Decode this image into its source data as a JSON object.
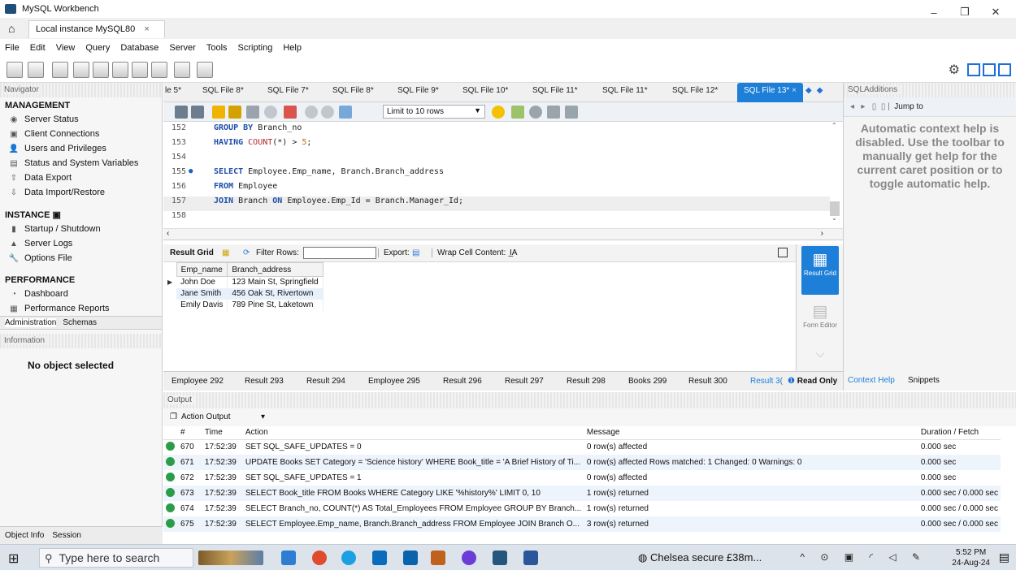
{
  "window": {
    "app_title": "MySQL Workbench",
    "minimize": "–",
    "maximize": "❐",
    "close": "✕"
  },
  "connection_tab": {
    "label": "Local instance MySQL80",
    "close": "×"
  },
  "menu": [
    "File",
    "Edit",
    "View",
    "Query",
    "Database",
    "Server",
    "Tools",
    "Scripting",
    "Help"
  ],
  "navigator": {
    "title": "Navigator",
    "management_title": "MANAGEMENT",
    "management": [
      "Server Status",
      "Client Connections",
      "Users and Privileges",
      "Status and System Variables",
      "Data Export",
      "Data Import/Restore"
    ],
    "instance_title": "INSTANCE",
    "instance": [
      "Startup / Shutdown",
      "Server Logs",
      "Options File"
    ],
    "performance_title": "PERFORMANCE",
    "performance": [
      "Dashboard",
      "Performance Reports"
    ],
    "tabs": [
      "Administration",
      "Schemas"
    ],
    "information_title": "Information",
    "no_object": "No object selected",
    "bottom_tabs": [
      "Object Info",
      "Session"
    ]
  },
  "editor_tabs": [
    "le 5*",
    "SQL File 8*",
    "SQL File 7*",
    "SQL File 8*",
    "SQL File 9*",
    "SQL File 10*",
    "SQL File 11*",
    "SQL File 11*",
    "SQL File 12*",
    "SQL File 13*"
  ],
  "sql_toolbar": {
    "limit": "Limit to 10 rows"
  },
  "code_lines": [
    {
      "num": "152",
      "parts": [
        [
          "kw",
          "GROUP BY "
        ],
        [
          "",
          "Branch_no"
        ]
      ]
    },
    {
      "num": "153",
      "parts": [
        [
          "kw",
          "HAVING "
        ],
        [
          "fn",
          "COUNT"
        ],
        [
          "",
          "(*) > "
        ],
        [
          "num",
          "5"
        ],
        [
          "",
          ";"
        ]
      ]
    },
    {
      "num": "154",
      "parts": []
    },
    {
      "num": "155",
      "dot": "●",
      "parts": [
        [
          "kw",
          "SELECT "
        ],
        [
          "",
          "Employee.Emp_name, Branch.Branch_address"
        ]
      ]
    },
    {
      "num": "156",
      "parts": [
        [
          "kw",
          "FROM "
        ],
        [
          "",
          "Employee"
        ]
      ]
    },
    {
      "num": "157",
      "current": true,
      "parts": [
        [
          "kw",
          "JOIN "
        ],
        [
          "",
          "Branch "
        ],
        [
          "kw",
          "ON "
        ],
        [
          "",
          "Employee.Emp_Id = Branch.Manager_Id;"
        ]
      ]
    },
    {
      "num": "158",
      "parts": []
    }
  ],
  "result_toolbar": {
    "result_grid": "Result Grid",
    "filter_rows": "Filter Rows:",
    "export": "Export:",
    "wrap": "Wrap Cell Content:"
  },
  "result_grid": {
    "columns": [
      "Emp_name",
      "Branch_address"
    ],
    "rows": [
      [
        "John Doe",
        "123 Main St, Springfield"
      ],
      [
        "Jane Smith",
        "456 Oak St, Rivertown"
      ],
      [
        "Emily Davis",
        "789 Pine St, Laketown"
      ]
    ]
  },
  "side_panel": {
    "result_grid": "Result Grid",
    "form_editor": "Form Editor"
  },
  "result_tabs": [
    "Employee 292",
    "Result 293",
    "Result 294",
    "Employee 295",
    "Result 296",
    "Result 297",
    "Result 298",
    "Books 299",
    "Result 300",
    "Result 3("
  ],
  "read_only": "Read Only",
  "sql_additions": {
    "title": "SQLAdditions",
    "jump_to": "Jump to",
    "help_text": "Automatic context help is disabled. Use the toolbar to manually get help for the current caret position or to toggle automatic help.",
    "tabs": [
      "Context Help",
      "Snippets"
    ]
  },
  "output": {
    "title": "Output",
    "selector": "Action Output",
    "columns": [
      "#",
      "Time",
      "Action",
      "Message",
      "Duration / Fetch"
    ],
    "rows": [
      [
        "670",
        "17:52:39",
        "SET SQL_SAFE_UPDATES = 0",
        "0 row(s) affected",
        "0.000 sec"
      ],
      [
        "671",
        "17:52:39",
        "UPDATE Books SET Category = 'Science history' WHERE Book_title = 'A Brief History of Ti...",
        "0 row(s) affected Rows matched: 1 Changed: 0 Warnings: 0",
        "0.000 sec"
      ],
      [
        "672",
        "17:52:39",
        "SET SQL_SAFE_UPDATES = 1",
        "0 row(s) affected",
        "0.000 sec"
      ],
      [
        "673",
        "17:52:39",
        "SELECT Book_title FROM Books WHERE Category LIKE '%history%' LIMIT 0, 10",
        "1 row(s) returned",
        "0.000 sec / 0.000 sec"
      ],
      [
        "674",
        "17:52:39",
        "SELECT Branch_no, COUNT(*) AS Total_Employees FROM Employee GROUP BY Branch...",
        "1 row(s) returned",
        "0.000 sec / 0.000 sec"
      ],
      [
        "675",
        "17:52:39",
        "SELECT Employee.Emp_name, Branch.Branch_address FROM Employee JOIN Branch O...",
        "3 row(s) returned",
        "0.000 sec / 0.000 sec"
      ]
    ]
  },
  "taskbar": {
    "search_placeholder": "Type here to search",
    "news": "Chelsea secure £38m...",
    "time": "5:52 PM",
    "date": "24-Aug-24"
  },
  "colors": {
    "accent": "#1e7fd8",
    "ok": "#2b9c47",
    "keyword": "#1f4fa8"
  }
}
